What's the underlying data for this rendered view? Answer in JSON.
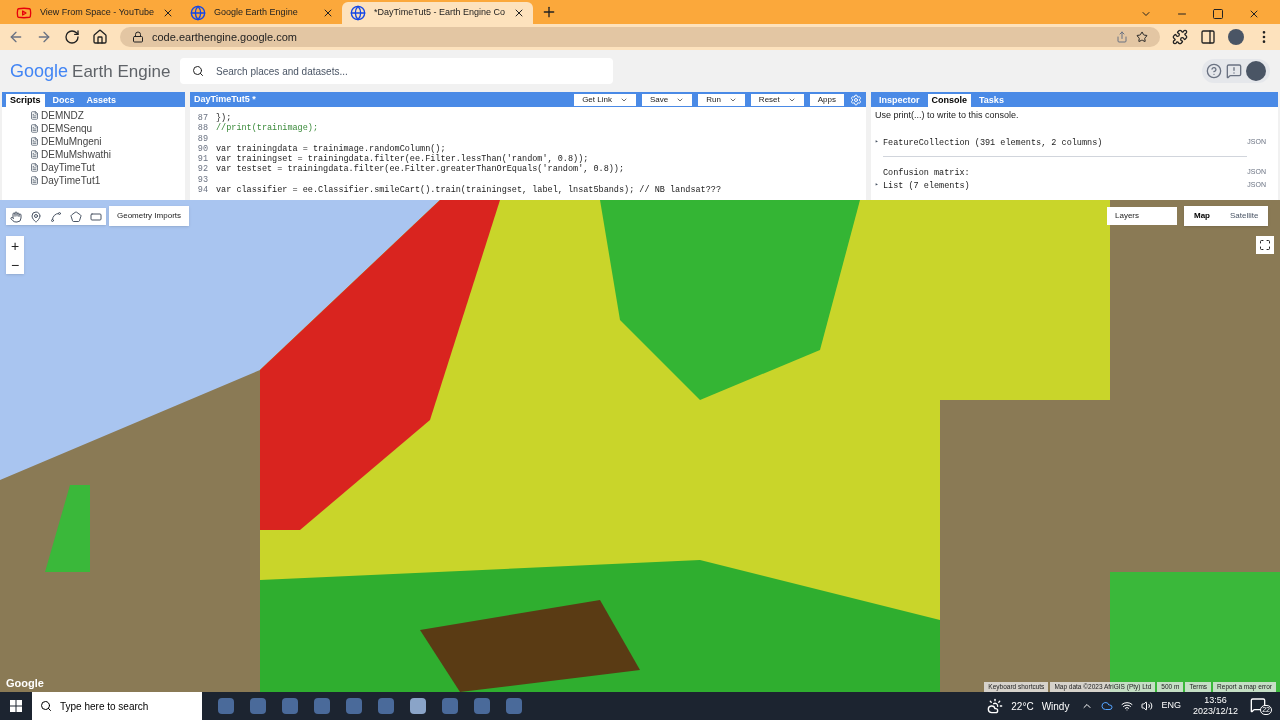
{
  "browser": {
    "tabs": [
      {
        "title": "View From Space - YouTube",
        "kind": "video",
        "selected": false
      },
      {
        "title": "Google Earth Engine",
        "kind": "globe",
        "selected": false
      },
      {
        "title": "*DayTimeTut5 - Earth Engine Co",
        "kind": "globe",
        "selected": true
      }
    ],
    "url": "code.earthengine.google.com"
  },
  "header": {
    "brand": "Google",
    "product": "Earth Engine",
    "search": {
      "placeholder": "Search places and datasets..."
    }
  },
  "left_panel": {
    "tabs": [
      {
        "label": "Scripts",
        "selected": true
      },
      {
        "label": "Docs",
        "selected": false
      },
      {
        "label": "Assets",
        "selected": false
      }
    ],
    "scripts": [
      "DEMNDZ",
      "DEMSenqu",
      "DEMuMngeni",
      "DEMuMshwathi",
      "DayTimeTut",
      "DayTimeTut1"
    ]
  },
  "editor": {
    "title": "DayTimeTut5 *",
    "buttons": [
      {
        "label": "Get Link",
        "dropdown": true
      },
      {
        "label": "Save",
        "dropdown": true
      },
      {
        "label": "Run",
        "dropdown": true
      },
      {
        "label": "Reset",
        "dropdown": true
      },
      {
        "label": "Apps",
        "dropdown": false
      }
    ],
    "lines": [
      {
        "number": "87",
        "code": "});",
        "kind": "code"
      },
      {
        "number": "88",
        "code": "//print(trainimage);",
        "kind": "comment"
      },
      {
        "number": "89"
      },
      {
        "number": "90",
        "code": "var trainingdata = trainimage.randomColumn();",
        "kind": "code"
      },
      {
        "number": "91",
        "code": "var trainingset = trainingdata.filter(ee.Filter.lessThan('random', 0.8));",
        "kind": "code"
      },
      {
        "number": "92",
        "code": "var testset = trainingdata.filter(ee.Filter.greaterThanOrEquals('random', 0.8));",
        "kind": "code"
      },
      {
        "number": "93"
      },
      {
        "number": "94",
        "code": "var classifier = ee.Classifier.smileCart().train(trainingset, label, lnsat5bands); // NB landsat???",
        "kind": "code"
      }
    ]
  },
  "right_panel": {
    "tabs": [
      {
        "label": "Inspector",
        "selected": false
      },
      {
        "label": "Console",
        "selected": true
      },
      {
        "label": "Tasks",
        "selected": false
      }
    ],
    "intro": "Use print(...) to write to this console.",
    "entries": [
      {
        "marker": "▸",
        "text": "FeatureCollection (391 elements, 2 columns)",
        "link": "JSON",
        "divider": true
      },
      {
        "text": "Confusion matrix:",
        "link": "JSON",
        "divider": false
      },
      {
        "marker": "▸",
        "text": "List (7 elements)",
        "link": "JSON",
        "divider": false
      }
    ]
  },
  "map": {
    "geometry_imports": "Geometry Imports",
    "layers": "Layers",
    "map_types": [
      {
        "label": "Map",
        "selected": true
      },
      {
        "label": "Satellite",
        "selected": false
      }
    ],
    "zoom_in": "+",
    "zoom_out": "−",
    "logo": "Google",
    "footer": [
      "Keyboard shortcuts",
      "Map data ©2023 AfriGIS (Pty) Ltd",
      "500 m",
      "Terms",
      "Report a map error"
    ]
  },
  "taskbar": {
    "search_placeholder": "Type here to search",
    "temperature": "22°C",
    "weather": "Windy",
    "language": "ENG",
    "time": "13:56",
    "date": "2023/12/12",
    "notifications": "22"
  }
}
